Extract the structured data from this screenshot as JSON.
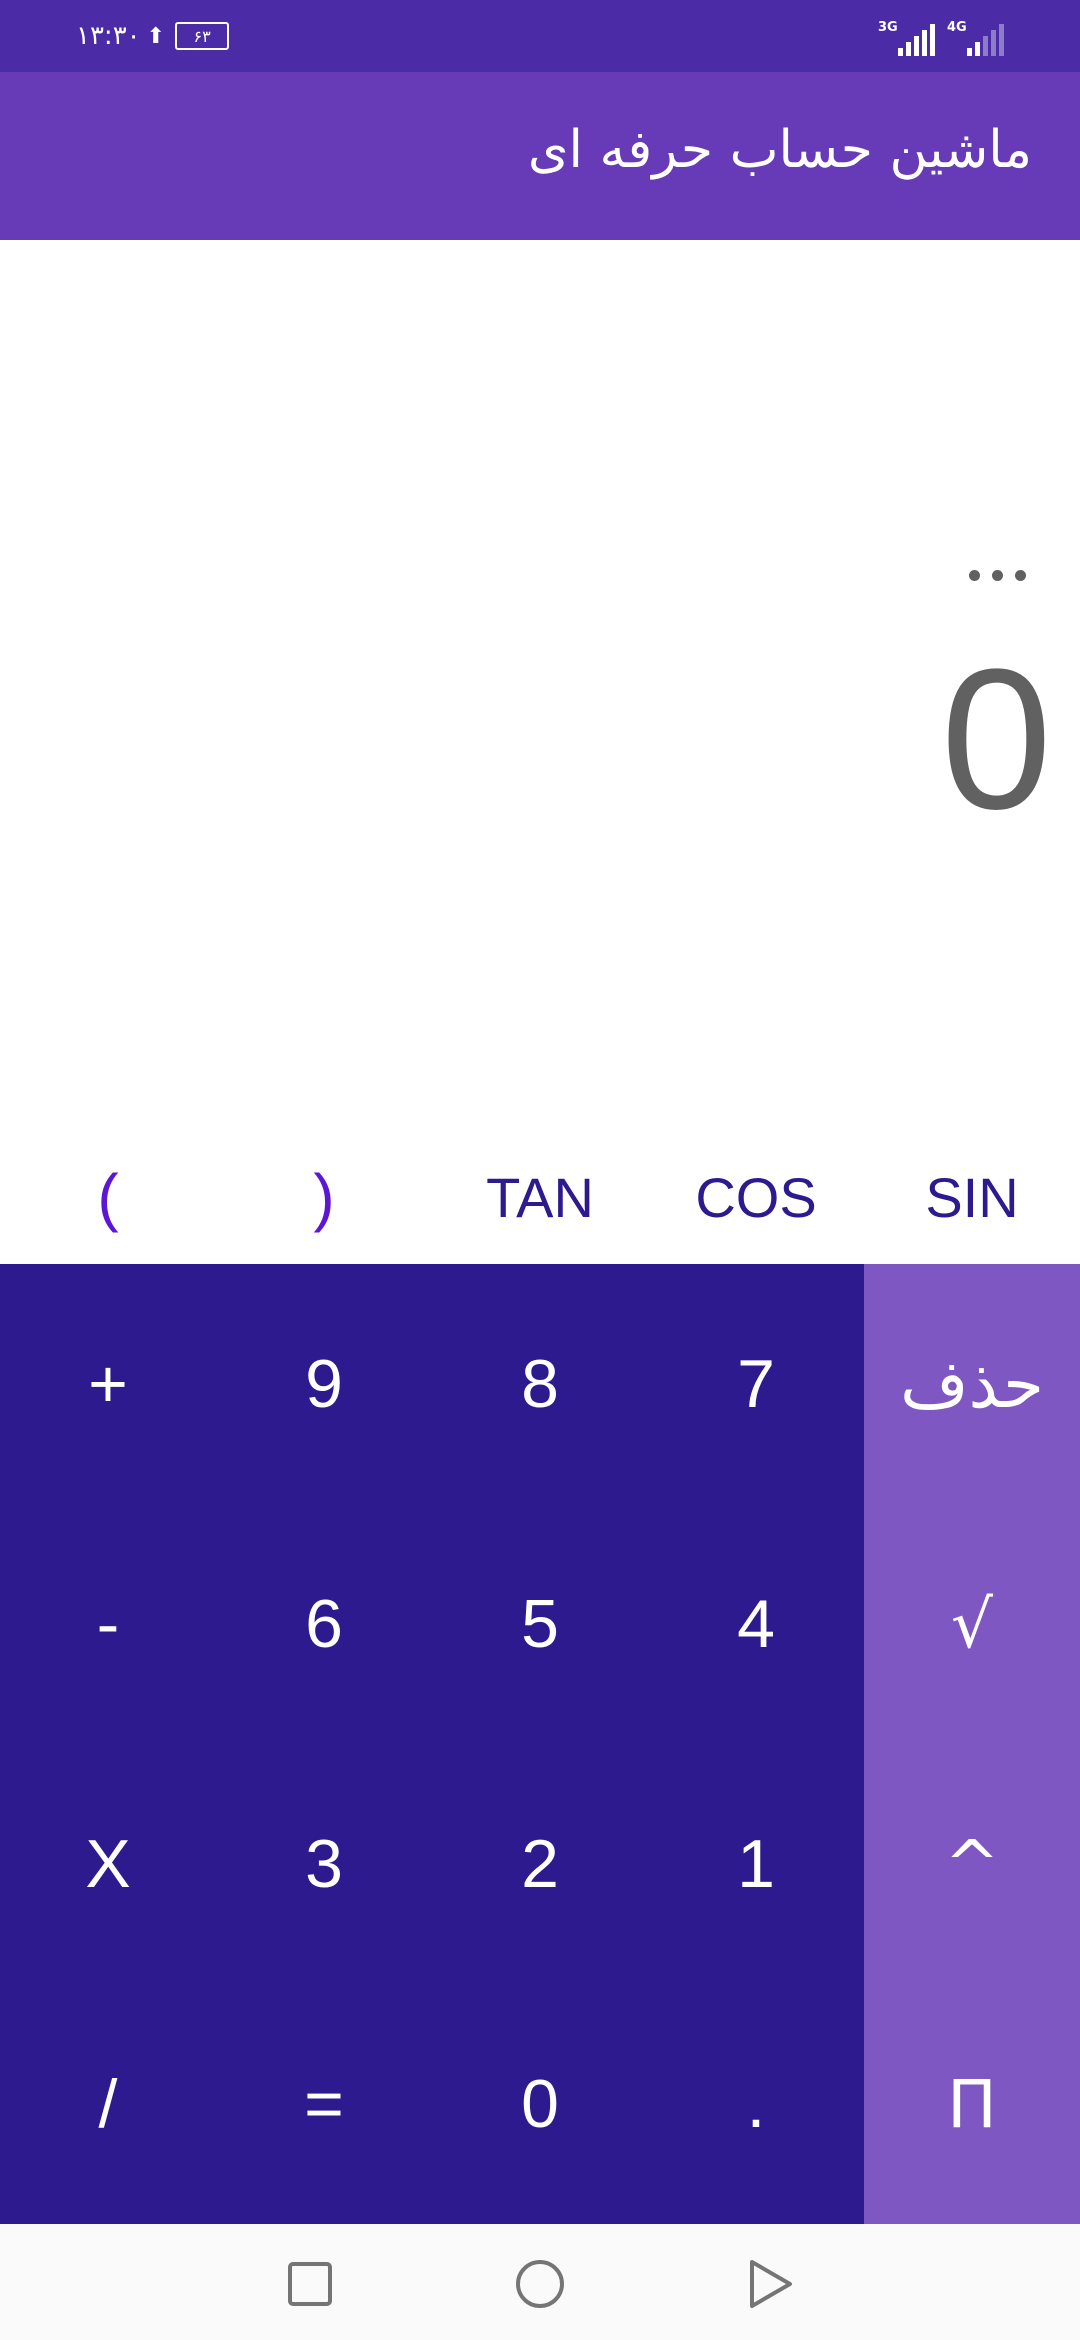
{
  "status_bar": {
    "time": "۱۳:۳۰",
    "battery": "۶۳",
    "network_1": "3G",
    "network_2": "4G"
  },
  "app_bar": {
    "title": "ماشین حساب حرفه ای"
  },
  "display": {
    "result": "0"
  },
  "scientific_keys": [
    "(",
    ")",
    "TAN",
    "COS",
    "SIN"
  ],
  "keypad": {
    "rows": [
      [
        "+",
        "9",
        "8",
        "7"
      ],
      [
        "-",
        "6",
        "5",
        "4"
      ],
      [
        "X",
        "3",
        "2",
        "1"
      ],
      [
        "/",
        "=",
        "0",
        "."
      ]
    ]
  },
  "side_keys": [
    "حذف",
    "√",
    "^",
    "Π"
  ],
  "colors": {
    "status_bar": "#4b2ca6",
    "app_bar": "#673ab7",
    "keypad": "#2e1a8f",
    "side_pad": "#7e57c2",
    "result_text": "#616161"
  },
  "nav": {
    "icons": [
      "recent-apps-icon",
      "home-icon",
      "back-icon"
    ]
  }
}
